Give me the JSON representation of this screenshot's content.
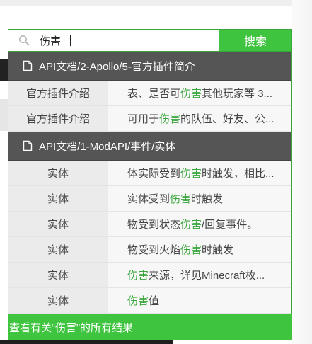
{
  "search": {
    "query": "伤害",
    "button_label": "搜索",
    "icon": "search-icon"
  },
  "groups": [
    {
      "title": "API文档/2-Apollo/5-官方插件简介",
      "icon": "document-icon",
      "rows": [
        {
          "category": "官方插件介绍",
          "before": "表、是否可",
          "highlight": "伤害",
          "after": "其他玩家等 3..."
        },
        {
          "category": "官方插件介绍",
          "before": "可用于",
          "highlight": "伤害",
          "after": "的队伍、好友、公..."
        }
      ]
    },
    {
      "title": "API文档/1-ModAPI/事件/实体",
      "icon": "document-icon",
      "rows": [
        {
          "category": "实体",
          "before": "体实际受到",
          "highlight": "伤害",
          "after": "时触发，相比..."
        },
        {
          "category": "实体",
          "before": "实体受到",
          "highlight": "伤害",
          "after": "时触发"
        },
        {
          "category": "实体",
          "before": "物受到状态",
          "highlight": "伤害",
          "after": "/回复事件。"
        },
        {
          "category": "实体",
          "before": "物受到火焰",
          "highlight": "伤害",
          "after": "时触发"
        },
        {
          "category": "实体",
          "before": "",
          "highlight": "伤害",
          "after": "来源，详见Minecraft枚..."
        },
        {
          "category": "实体",
          "before": "",
          "highlight": "伤害",
          "after": "值"
        }
      ]
    }
  ],
  "footer": {
    "label": "查看有关“伤害”的所有结果"
  },
  "colors": {
    "accent": "#3fc43f",
    "header_bg": "#555555",
    "highlight": "#3aa53c"
  }
}
